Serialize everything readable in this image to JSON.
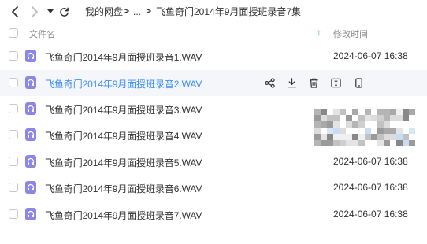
{
  "toolbar": {
    "breadcrumb": {
      "root": "我的网盘",
      "sep1": ">",
      "ellipsis": "...",
      "sep2": ">",
      "current": "飞鱼奇门2014年9月面授班录音7集"
    }
  },
  "list_header": {
    "name_label": "文件名",
    "sort_icon": "↑",
    "time_label": "修改时间"
  },
  "files": [
    {
      "name": "飞鱼奇门2014年9月面授班录音1.WAV",
      "modified": "2024-06-07 16:38"
    },
    {
      "name": "飞鱼奇门2014年9月面授班录音2.WAV",
      "modified": ""
    },
    {
      "name": "飞鱼奇门2014年9月面授班录音3.WAV",
      "modified": ""
    },
    {
      "name": "飞鱼奇门2014年9月面授班录音4.WAV",
      "modified": ""
    },
    {
      "name": "飞鱼奇门2014年9月面授班录音5.WAV",
      "modified": "2024-06-07 16:38"
    },
    {
      "name": "飞鱼奇门2014年9月面授班录音6.WAV",
      "modified": "2024-06-07 16:38"
    },
    {
      "name": "飞鱼奇门2014年9月面授班录音7.WAV",
      "modified": "2024-06-07 16:38"
    }
  ],
  "row_actions": [
    "share-icon",
    "download-icon",
    "delete-icon",
    "rename-icon",
    "send-to-phone-icon"
  ],
  "colors": {
    "accent": "#3e8ef7",
    "audio_icon": "#8b86e8",
    "hover_row": "#f4f6fa"
  }
}
